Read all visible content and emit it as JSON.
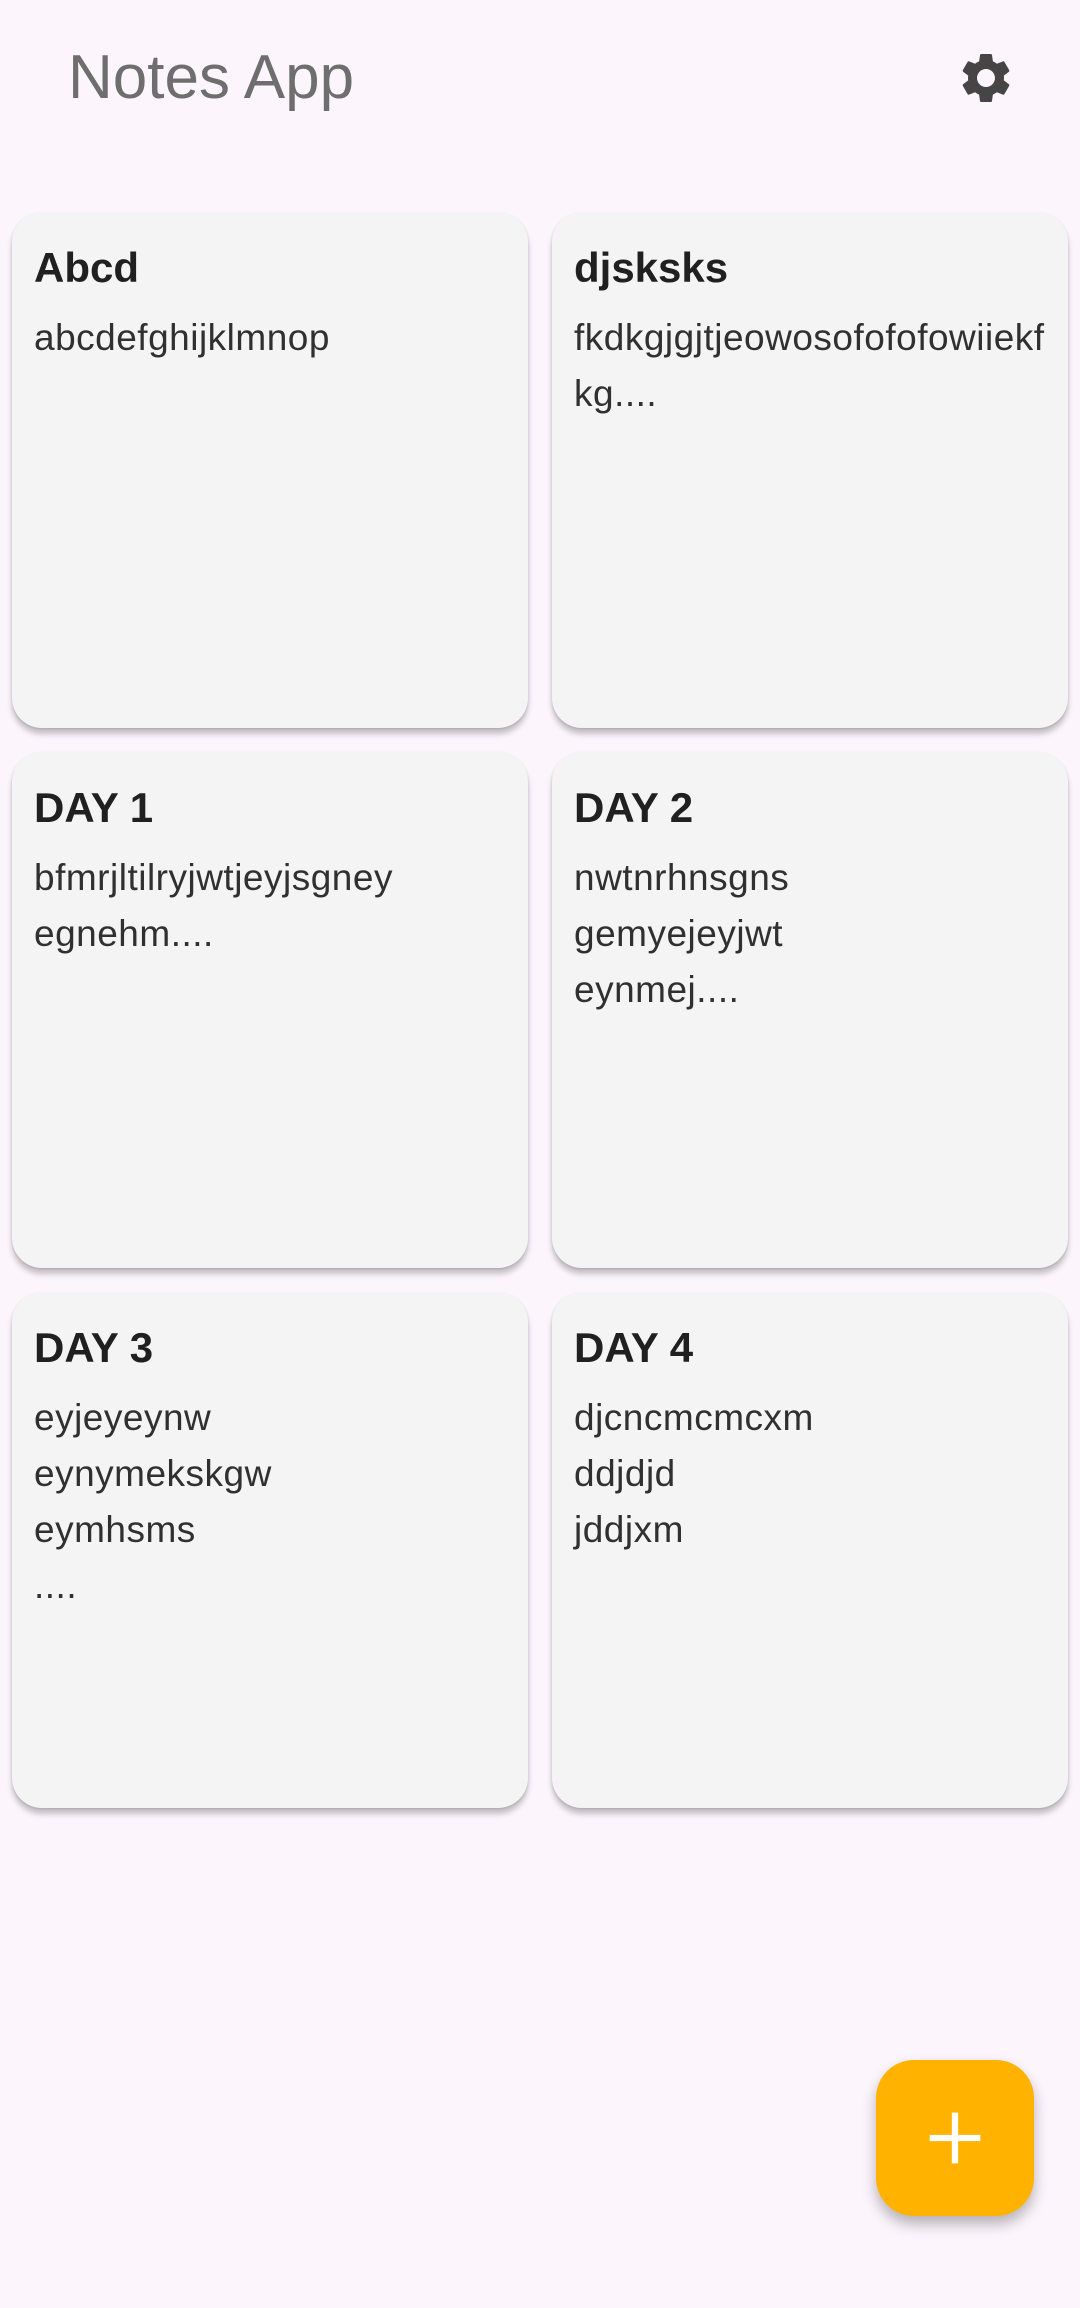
{
  "app_bar": {
    "title": "Notes App",
    "settings_icon": "gear-icon"
  },
  "notes": [
    {
      "title": "Abcd",
      "body": "abcdefghijklmnop"
    },
    {
      "title": "djsksks",
      "body": "fkdkgjgjtjeowosofofofowiiekfkg...."
    },
    {
      "title": "DAY 1",
      "body": "bfmrjltilryjwtjeyjsgney\negnehm...."
    },
    {
      "title": "DAY 2",
      "body": "nwtnrhnsgns\ngemyejeyjwt\neynmej...."
    },
    {
      "title": "DAY 3",
      "body": "eyjeyeynw\neynymekskgw\neymhsms\n...."
    },
    {
      "title": "DAY 4",
      "body": "djcncmcmcxm\nddjdjd\njddjxm"
    }
  ],
  "fab": {
    "icon": "plus-icon",
    "color": "#ffb300"
  },
  "colors": {
    "background": "#fcf5fc",
    "card": "#f4f4f4",
    "title_text": "#6e6e6e"
  }
}
